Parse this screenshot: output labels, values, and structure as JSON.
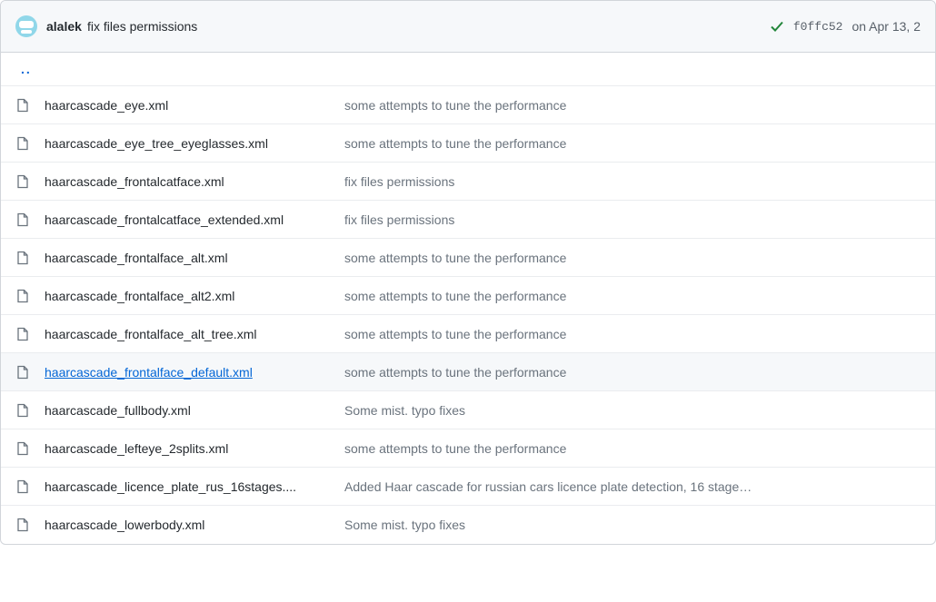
{
  "header": {
    "author": "alalek",
    "message": "fix files permissions",
    "commit_hash": "f0ffc52",
    "date": "on Apr 13, 2"
  },
  "parent": "..",
  "files": [
    {
      "name": "haarcascade_eye.xml",
      "msg": "some attempts to tune the performance",
      "hovered": false
    },
    {
      "name": "haarcascade_eye_tree_eyeglasses.xml",
      "msg": "some attempts to tune the performance",
      "hovered": false
    },
    {
      "name": "haarcascade_frontalcatface.xml",
      "msg": "fix files permissions",
      "hovered": false
    },
    {
      "name": "haarcascade_frontalcatface_extended.xml",
      "msg": "fix files permissions",
      "hovered": false
    },
    {
      "name": "haarcascade_frontalface_alt.xml",
      "msg": "some attempts to tune the performance",
      "hovered": false
    },
    {
      "name": "haarcascade_frontalface_alt2.xml",
      "msg": "some attempts to tune the performance",
      "hovered": false
    },
    {
      "name": "haarcascade_frontalface_alt_tree.xml",
      "msg": "some attempts to tune the performance",
      "hovered": false
    },
    {
      "name": "haarcascade_frontalface_default.xml",
      "msg": "some attempts to tune the performance",
      "hovered": true
    },
    {
      "name": "haarcascade_fullbody.xml",
      "msg": "Some mist. typo fixes",
      "hovered": false
    },
    {
      "name": "haarcascade_lefteye_2splits.xml",
      "msg": "some attempts to tune the performance",
      "hovered": false
    },
    {
      "name": "haarcascade_licence_plate_rus_16stages....",
      "msg": "Added Haar cascade for russian cars licence plate detection, 16 stage…",
      "hovered": false
    },
    {
      "name": "haarcascade_lowerbody.xml",
      "msg": "Some mist. typo fixes",
      "hovered": false
    }
  ]
}
